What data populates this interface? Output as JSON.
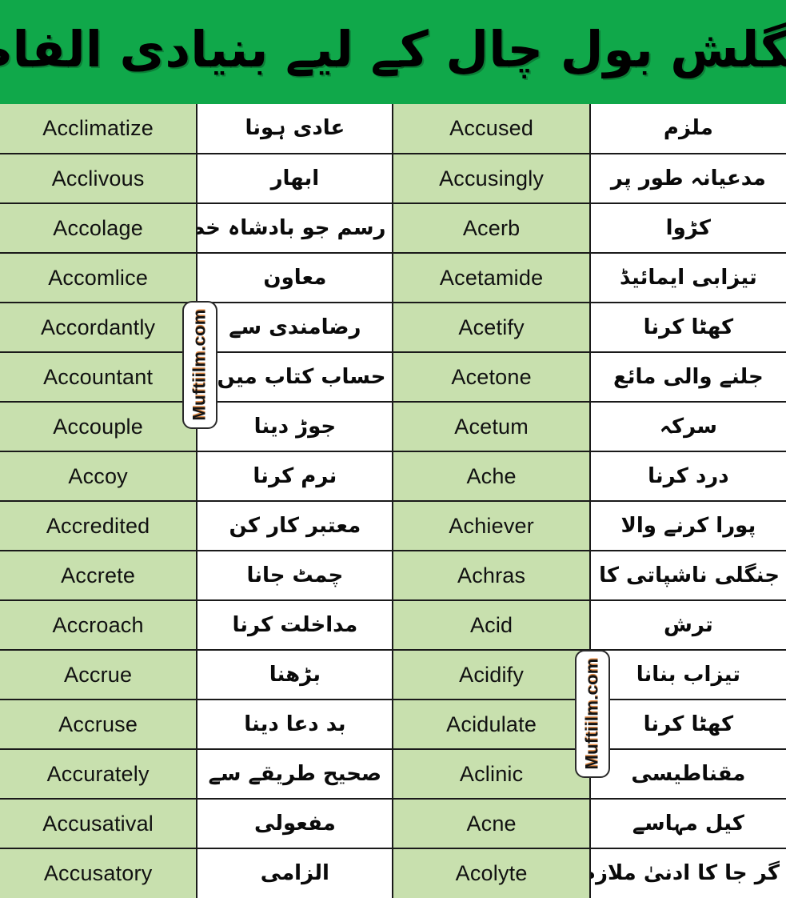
{
  "header": {
    "title_urdu": "انگلش بول چال کے لیے بنیادی الفاظ",
    "background_color": "#10a84a",
    "text_color": "#000000"
  },
  "theme": {
    "header_green": "#10a84a",
    "cell_green": "#c8e0ae",
    "cell_white": "#ffffff",
    "grid_line": "#1a1a1a",
    "watermark_accent": "#e07a28"
  },
  "watermarks": [
    {
      "text": "Muftiilm.com",
      "position": "left-middle"
    },
    {
      "text": "Muftiilm.com",
      "position": "right-lower"
    }
  ],
  "table": {
    "rows": [
      {
        "en_left": "Acclimatize",
        "ur_left": "عادی ہونا",
        "en_right": "Accused",
        "ur_right": "ملزم"
      },
      {
        "en_left": "Acclivous",
        "ur_left": "ابھار",
        "en_right": "Accusingly",
        "ur_right": "مدعیانہ طور پر"
      },
      {
        "en_left": "Accolage",
        "ur_left": "رسم جو بادشاہ خطاب کے",
        "en_right": "Acerb",
        "ur_right": "کڑوا"
      },
      {
        "en_left": "Accomlice",
        "ur_left": "معاون",
        "en_right": "Acetamide",
        "ur_right": "تیزابی ایمائیڈ"
      },
      {
        "en_left": "Accordantly",
        "ur_left": "رضامندی سے",
        "en_right": "Acetify",
        "ur_right": "کھٹا کرنا"
      },
      {
        "en_left": "Accountant",
        "ur_left": "حساب کتاب میں ماہر",
        "en_right": "Acetone",
        "ur_right": "جلنے والی مائع"
      },
      {
        "en_left": "Accouple",
        "ur_left": "جوڑ دینا",
        "en_right": "Acetum",
        "ur_right": "سرکہ"
      },
      {
        "en_left": "Accoy",
        "ur_left": "نرم کرنا",
        "en_right": "Ache",
        "ur_right": "درد کرنا"
      },
      {
        "en_left": "Accredited",
        "ur_left": "معتبر کار کن",
        "en_right": "Achiever",
        "ur_right": "پورا کرنے والا"
      },
      {
        "en_left": "Accrete",
        "ur_left": "چمٹ جانا",
        "en_right": "Achras",
        "ur_right": "جنگلی ناشپاتی کا درخت"
      },
      {
        "en_left": "Accroach",
        "ur_left": "مداخلت کرنا",
        "en_right": "Acid",
        "ur_right": "ترش"
      },
      {
        "en_left": "Accrue",
        "ur_left": "بڑھنا",
        "en_right": "Acidify",
        "ur_right": "تیزاب بنانا"
      },
      {
        "en_left": "Accruse",
        "ur_left": "بد دعا دینا",
        "en_right": "Acidulate",
        "ur_right": "کھٹا کرنا"
      },
      {
        "en_left": "Accurately",
        "ur_left": "صحیح طریقے سے",
        "en_right": "Aclinic",
        "ur_right": "مقناطیسی"
      },
      {
        "en_left": "Accusatival",
        "ur_left": "مفعولی",
        "en_right": "Acne",
        "ur_right": "کیل مہاسے"
      },
      {
        "en_left": "Accusatory",
        "ur_left": "الزامی",
        "en_right": "Acolyte",
        "ur_right": "گر جا کا ادنیٰ ملازم"
      }
    ]
  }
}
